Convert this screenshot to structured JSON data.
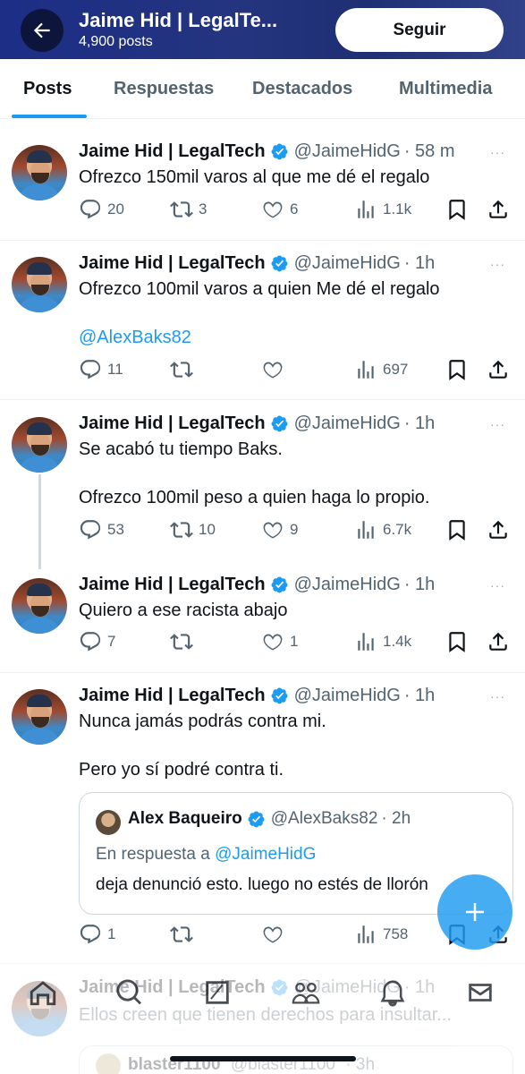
{
  "header": {
    "name": "Jaime Hid | LegalTe...",
    "posts_count": "4,900 posts",
    "follow_label": "Seguir"
  },
  "tabs": [
    {
      "label": "Posts",
      "active": true
    },
    {
      "label": "Respuestas",
      "active": false
    },
    {
      "label": "Destacados",
      "active": false
    },
    {
      "label": "Multimedia",
      "active": false
    }
  ],
  "posts": [
    {
      "author": "Jaime Hid | LegalTech",
      "handle": "@JaimeHidG",
      "time": "· 58 m",
      "text": "Ofrezco 150mil varos al que me dé el regalo",
      "replies": "20",
      "reposts": "3",
      "likes": "6",
      "views": "1.1k"
    },
    {
      "author": "Jaime Hid | LegalTech",
      "handle": "@JaimeHidG",
      "time": "· 1h",
      "text": "Ofrezco 100mil varos a quien Me dé el regalo",
      "mention": "@AlexBaks82",
      "replies": "11",
      "reposts": "",
      "likes": "",
      "views": "697"
    },
    {
      "author": "Jaime Hid | LegalTech",
      "handle": "@JaimeHidG",
      "time": "· 1h",
      "text": "Se acabó tu tiempo Baks.",
      "text2": "Ofrezco 100mil peso a quien haga lo propio.",
      "replies": "53",
      "reposts": "10",
      "likes": "9",
      "views": "6.7k"
    },
    {
      "author": "Jaime Hid | LegalTech",
      "handle": "@JaimeHidG",
      "time": "· 1h",
      "text": "Quiero a ese racista abajo",
      "replies": "7",
      "reposts": "",
      "likes": "1",
      "views": "1.4k"
    },
    {
      "author": "Jaime Hid | LegalTech",
      "handle": "@JaimeHidG",
      "time": "· 1h",
      "text": "Nunca jamás podrás contra mi.",
      "text2": "Pero yo sí podré contra ti.",
      "replies": "1",
      "reposts": "",
      "likes": "",
      "views": "758",
      "quote": {
        "author": "Alex Baqueiro",
        "handle": "@AlexBaks82",
        "time": "· 2h",
        "reply_prefix": "En respuesta a",
        "reply_to": "@JaimeHidG",
        "text": "deja denunció esto. luego no estés de llorón"
      }
    },
    {
      "author": "Jaime Hid | LegalTech",
      "handle": "@JaimeHidG",
      "time": "· 1h",
      "text": "Ellos creen que tienen derechos para insultar...",
      "quote": {
        "author": "blaster1100",
        "handle": "@blaster1100",
        "time": "· 3h"
      }
    }
  ],
  "more_label": "···",
  "colors": {
    "accent": "#1d9bf0",
    "header_bg": "#1f2f7a",
    "text_secondary": "#536471"
  },
  "icons": [
    "back-arrow-icon",
    "verified-icon",
    "more-icon",
    "reply-icon",
    "repost-icon",
    "like-icon",
    "views-icon",
    "bookmark-icon",
    "share-icon",
    "compose-plus-icon",
    "home-icon",
    "search-icon",
    "grok-icon",
    "communities-icon",
    "notifications-icon",
    "messages-icon"
  ]
}
